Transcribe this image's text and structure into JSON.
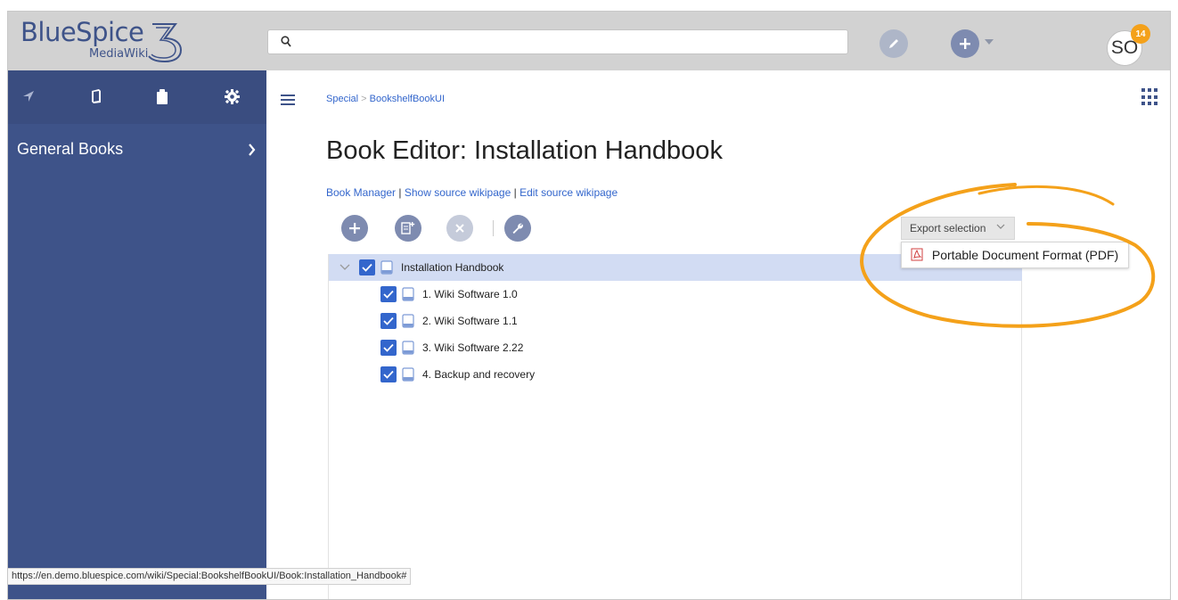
{
  "header": {
    "logo_brand": "BlueSpice",
    "logo_sub": "MediaWiki",
    "search_placeholder": "",
    "avatar_initials": "SO",
    "notification_count": "14"
  },
  "sidebar": {
    "tabs": [
      "navigation-icon",
      "book-icon",
      "clipboard-icon",
      "gear-icon"
    ],
    "items": [
      {
        "label": "General Books"
      }
    ]
  },
  "breadcrumb": {
    "parent": "Special",
    "separator": ">",
    "current": "BookshelfBookUI"
  },
  "page": {
    "title": "Book Editor: Installation Handbook",
    "links": [
      "Book Manager",
      "Show source wikipage",
      "Edit source wikipage"
    ],
    "link_separator": "|"
  },
  "toolbar": {
    "tools": [
      "add-icon",
      "add-page-icon",
      "remove-icon",
      "wrench-icon"
    ]
  },
  "export": {
    "button_label": "Export selection",
    "menu_items": [
      {
        "label": "Portable Document Format (PDF)"
      }
    ]
  },
  "tree": {
    "root": {
      "label": "Installation Handbook",
      "checked": true,
      "expanded": true
    },
    "children": [
      {
        "label": "1. Wiki Software 1.0",
        "checked": true
      },
      {
        "label": "2. Wiki Software 1.1",
        "checked": true
      },
      {
        "label": "3. Wiki Software 2.22",
        "checked": true
      },
      {
        "label": "4. Backup and recovery",
        "checked": true
      }
    ]
  },
  "status_bar": {
    "url": "https://en.demo.bluespice.com/wiki/Special:BookshelfBookUI/Book:Installation_Handbook#"
  },
  "colors": {
    "sidebar": "#3e5389",
    "accent": "#3366cc",
    "highlight_row": "#d2dcf3",
    "annotation": "#f4a11a"
  }
}
